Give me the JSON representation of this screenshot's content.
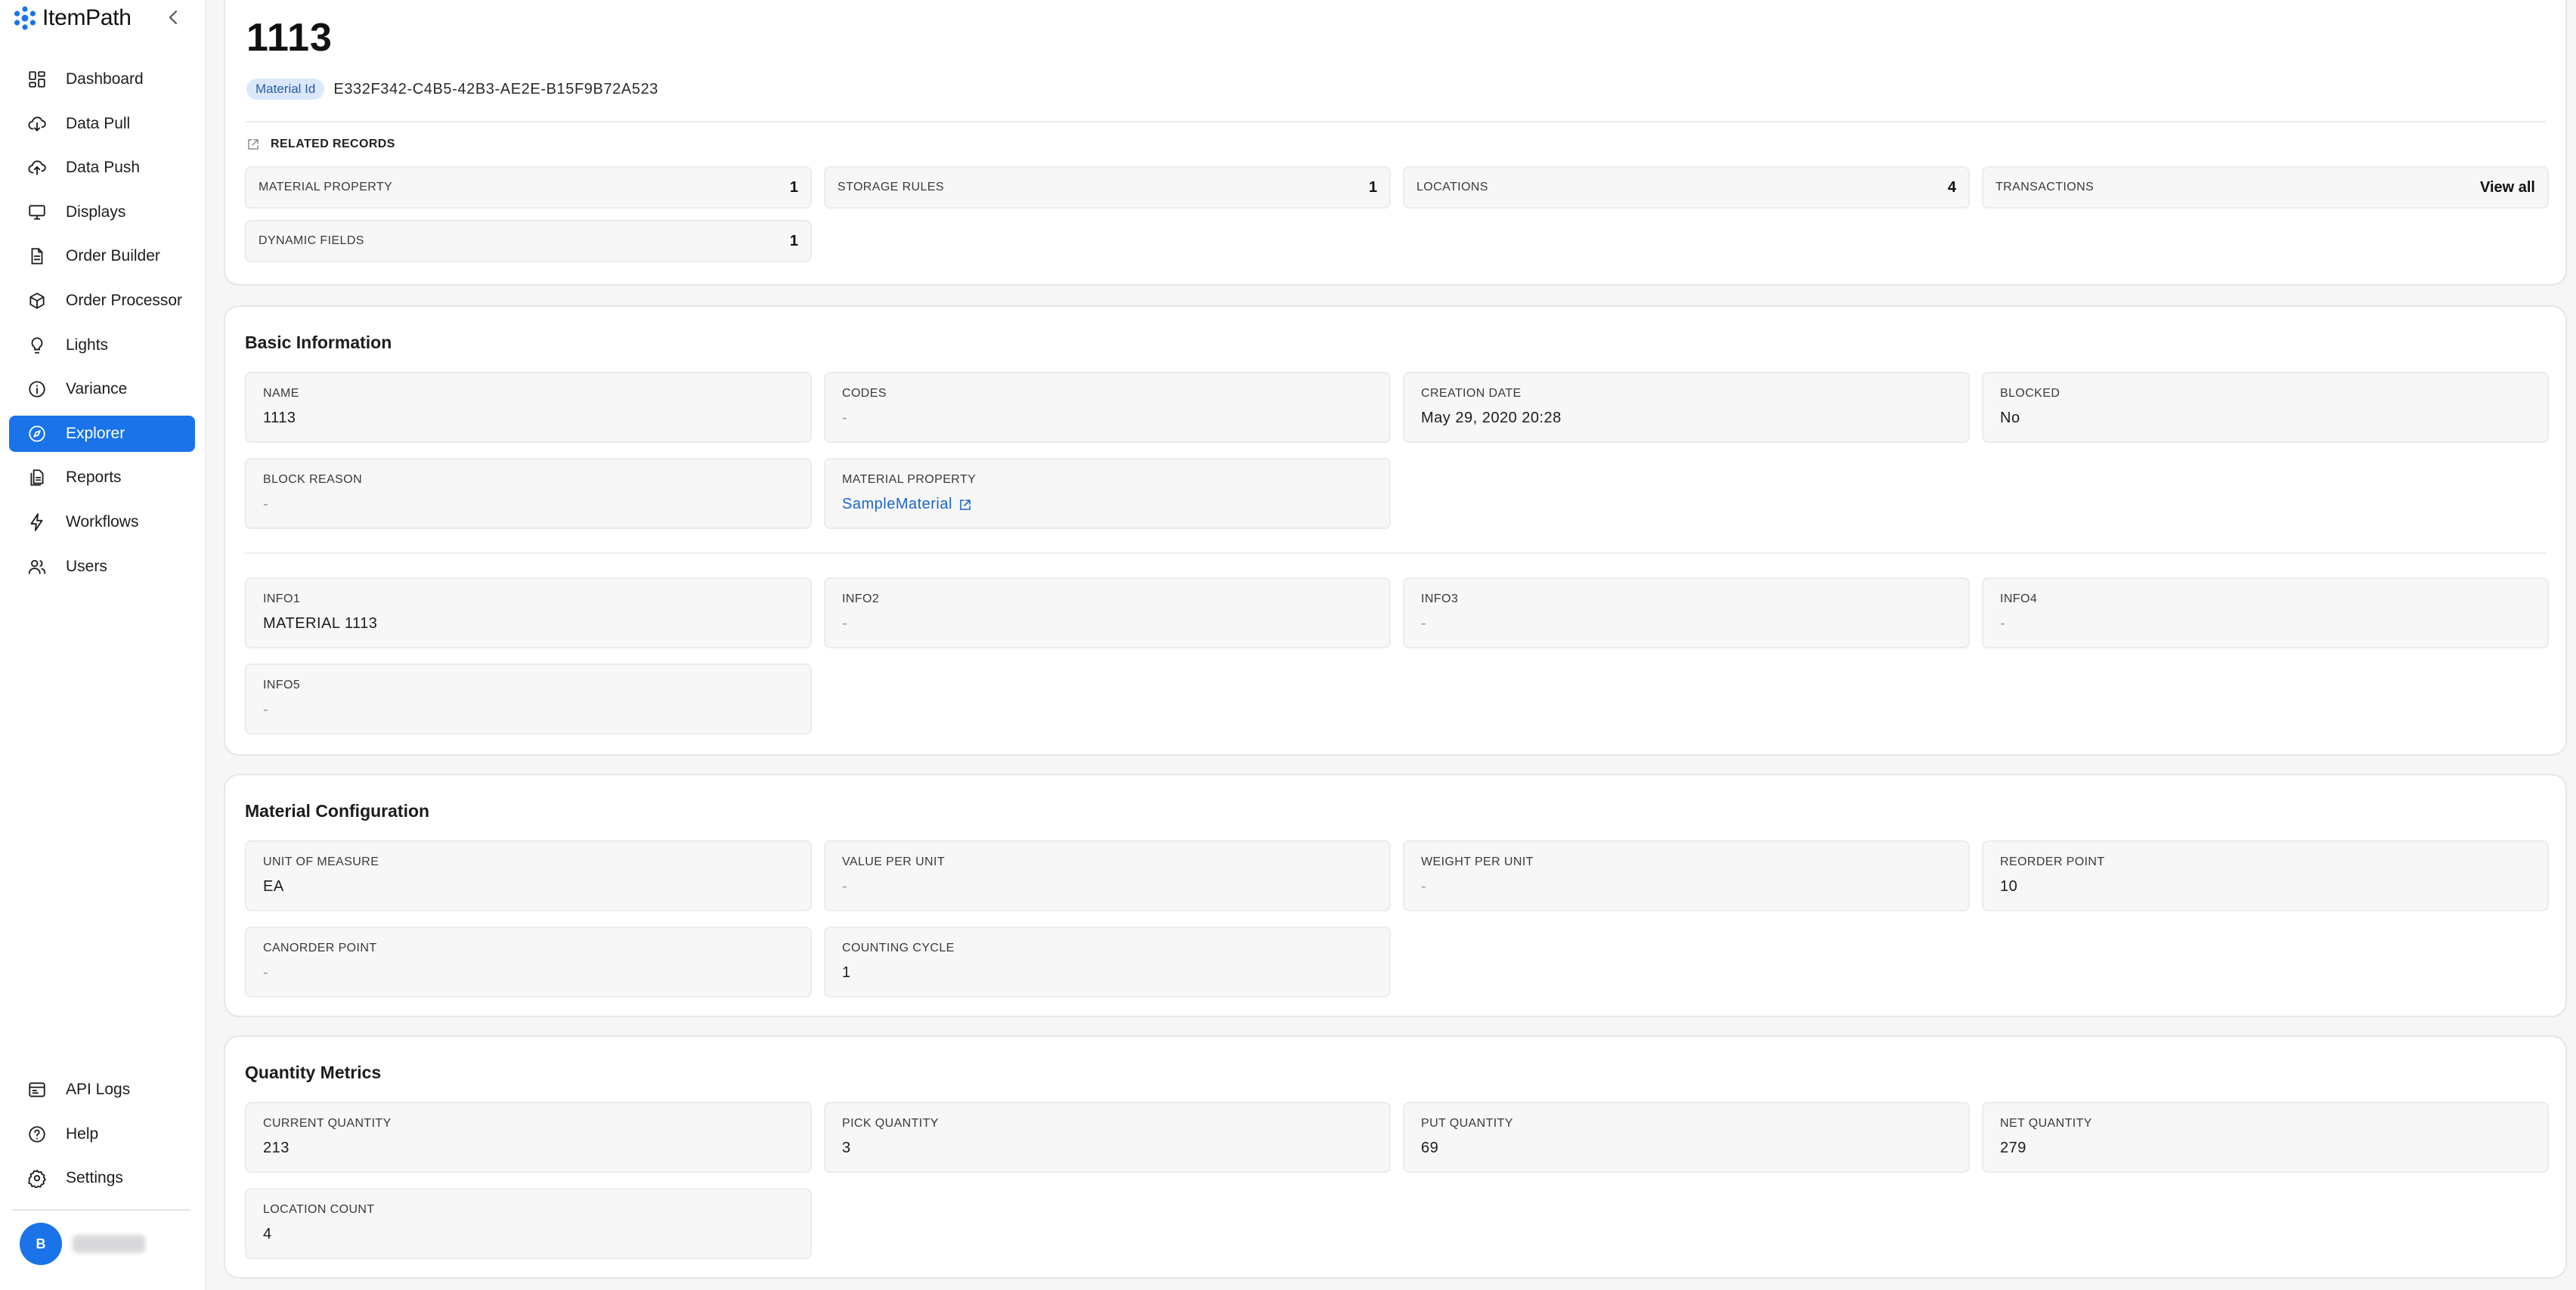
{
  "brand": {
    "name": "ItemPath"
  },
  "sidebar": {
    "items": [
      {
        "label": "Dashboard",
        "icon": "dashboard-icon"
      },
      {
        "label": "Data Pull",
        "icon": "cloud-download-icon"
      },
      {
        "label": "Data Push",
        "icon": "cloud-upload-icon"
      },
      {
        "label": "Displays",
        "icon": "monitor-icon"
      },
      {
        "label": "Order Builder",
        "icon": "document-icon"
      },
      {
        "label": "Order Processor",
        "icon": "box-icon"
      },
      {
        "label": "Lights",
        "icon": "lightbulb-icon"
      },
      {
        "label": "Variance",
        "icon": "info-circle-icon"
      },
      {
        "label": "Explorer",
        "icon": "compass-icon",
        "active": true
      },
      {
        "label": "Reports",
        "icon": "reports-icon"
      },
      {
        "label": "Workflows",
        "icon": "lightning-icon"
      },
      {
        "label": "Users",
        "icon": "users-icon"
      }
    ],
    "bottom_items": [
      {
        "label": "API Logs",
        "icon": "api-logs-icon"
      },
      {
        "label": "Help",
        "icon": "help-icon"
      },
      {
        "label": "Settings",
        "icon": "gear-icon"
      }
    ],
    "user": {
      "initial": "B"
    }
  },
  "header": {
    "title": "1113",
    "id_badge": "Material Id",
    "id_value": "E332F342-C4B5-42B3-AE2E-B15F9B72A523",
    "related_title": "RELATED RECORDS",
    "related": [
      {
        "label": "MATERIAL PROPERTY",
        "value": "1"
      },
      {
        "label": "STORAGE RULES",
        "value": "1"
      },
      {
        "label": "LOCATIONS",
        "value": "4"
      },
      {
        "label": "TRANSACTIONS",
        "value": "View all"
      },
      {
        "label": "DYNAMIC FIELDS",
        "value": "1"
      }
    ]
  },
  "basic": {
    "title": "Basic Information",
    "fields": [
      {
        "label": "NAME",
        "value": "1113"
      },
      {
        "label": "CODES",
        "value": "-"
      },
      {
        "label": "CREATION DATE",
        "value": "May 29, 2020 20:28"
      },
      {
        "label": "BLOCKED",
        "value": "No"
      },
      {
        "label": "BLOCK REASON",
        "value": "-"
      },
      {
        "label": "MATERIAL PROPERTY",
        "value": "SampleMaterial"
      }
    ],
    "info_fields": [
      {
        "label": "INFO1",
        "value": "MATERIAL 1113"
      },
      {
        "label": "INFO2",
        "value": "-"
      },
      {
        "label": "INFO3",
        "value": "-"
      },
      {
        "label": "INFO4",
        "value": "-"
      },
      {
        "label": "INFO5",
        "value": "-"
      }
    ]
  },
  "config": {
    "title": "Material Configuration",
    "fields": [
      {
        "label": "UNIT OF MEASURE",
        "value": "EA"
      },
      {
        "label": "VALUE PER UNIT",
        "value": "-"
      },
      {
        "label": "WEIGHT PER UNIT",
        "value": "-"
      },
      {
        "label": "REORDER POINT",
        "value": "10"
      },
      {
        "label": "CANORDER POINT",
        "value": "-"
      },
      {
        "label": "COUNTING CYCLE",
        "value": "1"
      }
    ]
  },
  "metrics": {
    "title": "Quantity Metrics",
    "fields": [
      {
        "label": "CURRENT QUANTITY",
        "value": "213"
      },
      {
        "label": "PICK QUANTITY",
        "value": "3"
      },
      {
        "label": "PUT QUANTITY",
        "value": "69"
      },
      {
        "label": "NET QUANTITY",
        "value": "279"
      },
      {
        "label": "LOCATION COUNT",
        "value": "4"
      }
    ]
  },
  "colors": {
    "accent": "#1a73e8",
    "link": "#1a66d2",
    "badge_bg": "#dbe8fb"
  }
}
